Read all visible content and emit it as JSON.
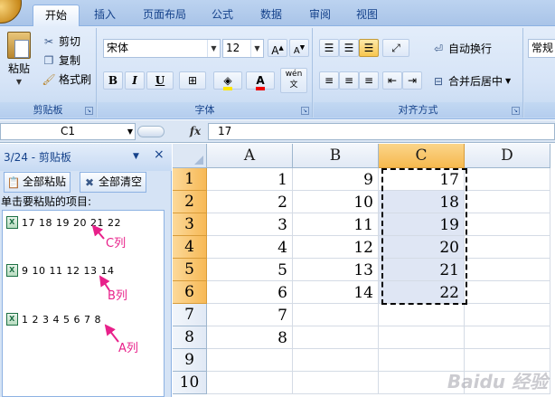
{
  "tabs": [
    "开始",
    "插入",
    "页面布局",
    "公式",
    "数据",
    "审阅",
    "视图"
  ],
  "clipboard_group": {
    "paste_label": "粘贴",
    "cut_label": "剪切",
    "copy_label": "复制",
    "format_painter_label": "格式刷",
    "group_label": "剪贴板"
  },
  "font_group": {
    "font_name": "宋体",
    "font_size": "12",
    "bold": "B",
    "italic": "I",
    "underline": "U",
    "phonetic": "wén 文",
    "group_label": "字体"
  },
  "alignment_group": {
    "wrap_text_label": "自动换行",
    "merge_center_label": "合并后居中",
    "group_label": "对齐方式"
  },
  "number_group": {
    "format_value": "常规"
  },
  "formula_bar": {
    "name_box": "C1",
    "fx": "fx",
    "value": "17"
  },
  "clipboard_pane": {
    "title": "3/24 - 剪贴板",
    "paste_all_label": "全部粘贴",
    "clear_all_label": "全部清空",
    "hint": "单击要粘贴的项目:",
    "items": [
      {
        "text": "17 18 19 20 21 22",
        "annotation": "C列"
      },
      {
        "text": "9 10 11 12 13 14",
        "annotation": "B列"
      },
      {
        "text": "1 2 3 4 5 6 7 8",
        "annotation": "A列"
      }
    ]
  },
  "sheet": {
    "columns": [
      "A",
      "B",
      "C",
      "D"
    ],
    "rows": [
      "1",
      "2",
      "3",
      "4",
      "5",
      "6",
      "7",
      "8",
      "9",
      "10"
    ],
    "cells": [
      [
        "1",
        "9",
        "17",
        ""
      ],
      [
        "2",
        "10",
        "18",
        ""
      ],
      [
        "3",
        "11",
        "19",
        ""
      ],
      [
        "4",
        "12",
        "20",
        ""
      ],
      [
        "5",
        "13",
        "21",
        ""
      ],
      [
        "6",
        "14",
        "22",
        ""
      ],
      [
        "7",
        "",
        "",
        ""
      ],
      [
        "8",
        "",
        "",
        ""
      ],
      [
        "",
        "",
        "",
        ""
      ],
      [
        "",
        "",
        "",
        ""
      ]
    ],
    "selected_column": "C"
  },
  "watermark": "Baidu 经验",
  "colors": {
    "annotation": "#e8208a",
    "selected_header": "#f6b94f",
    "selection_fill": "#dfe6f4"
  }
}
